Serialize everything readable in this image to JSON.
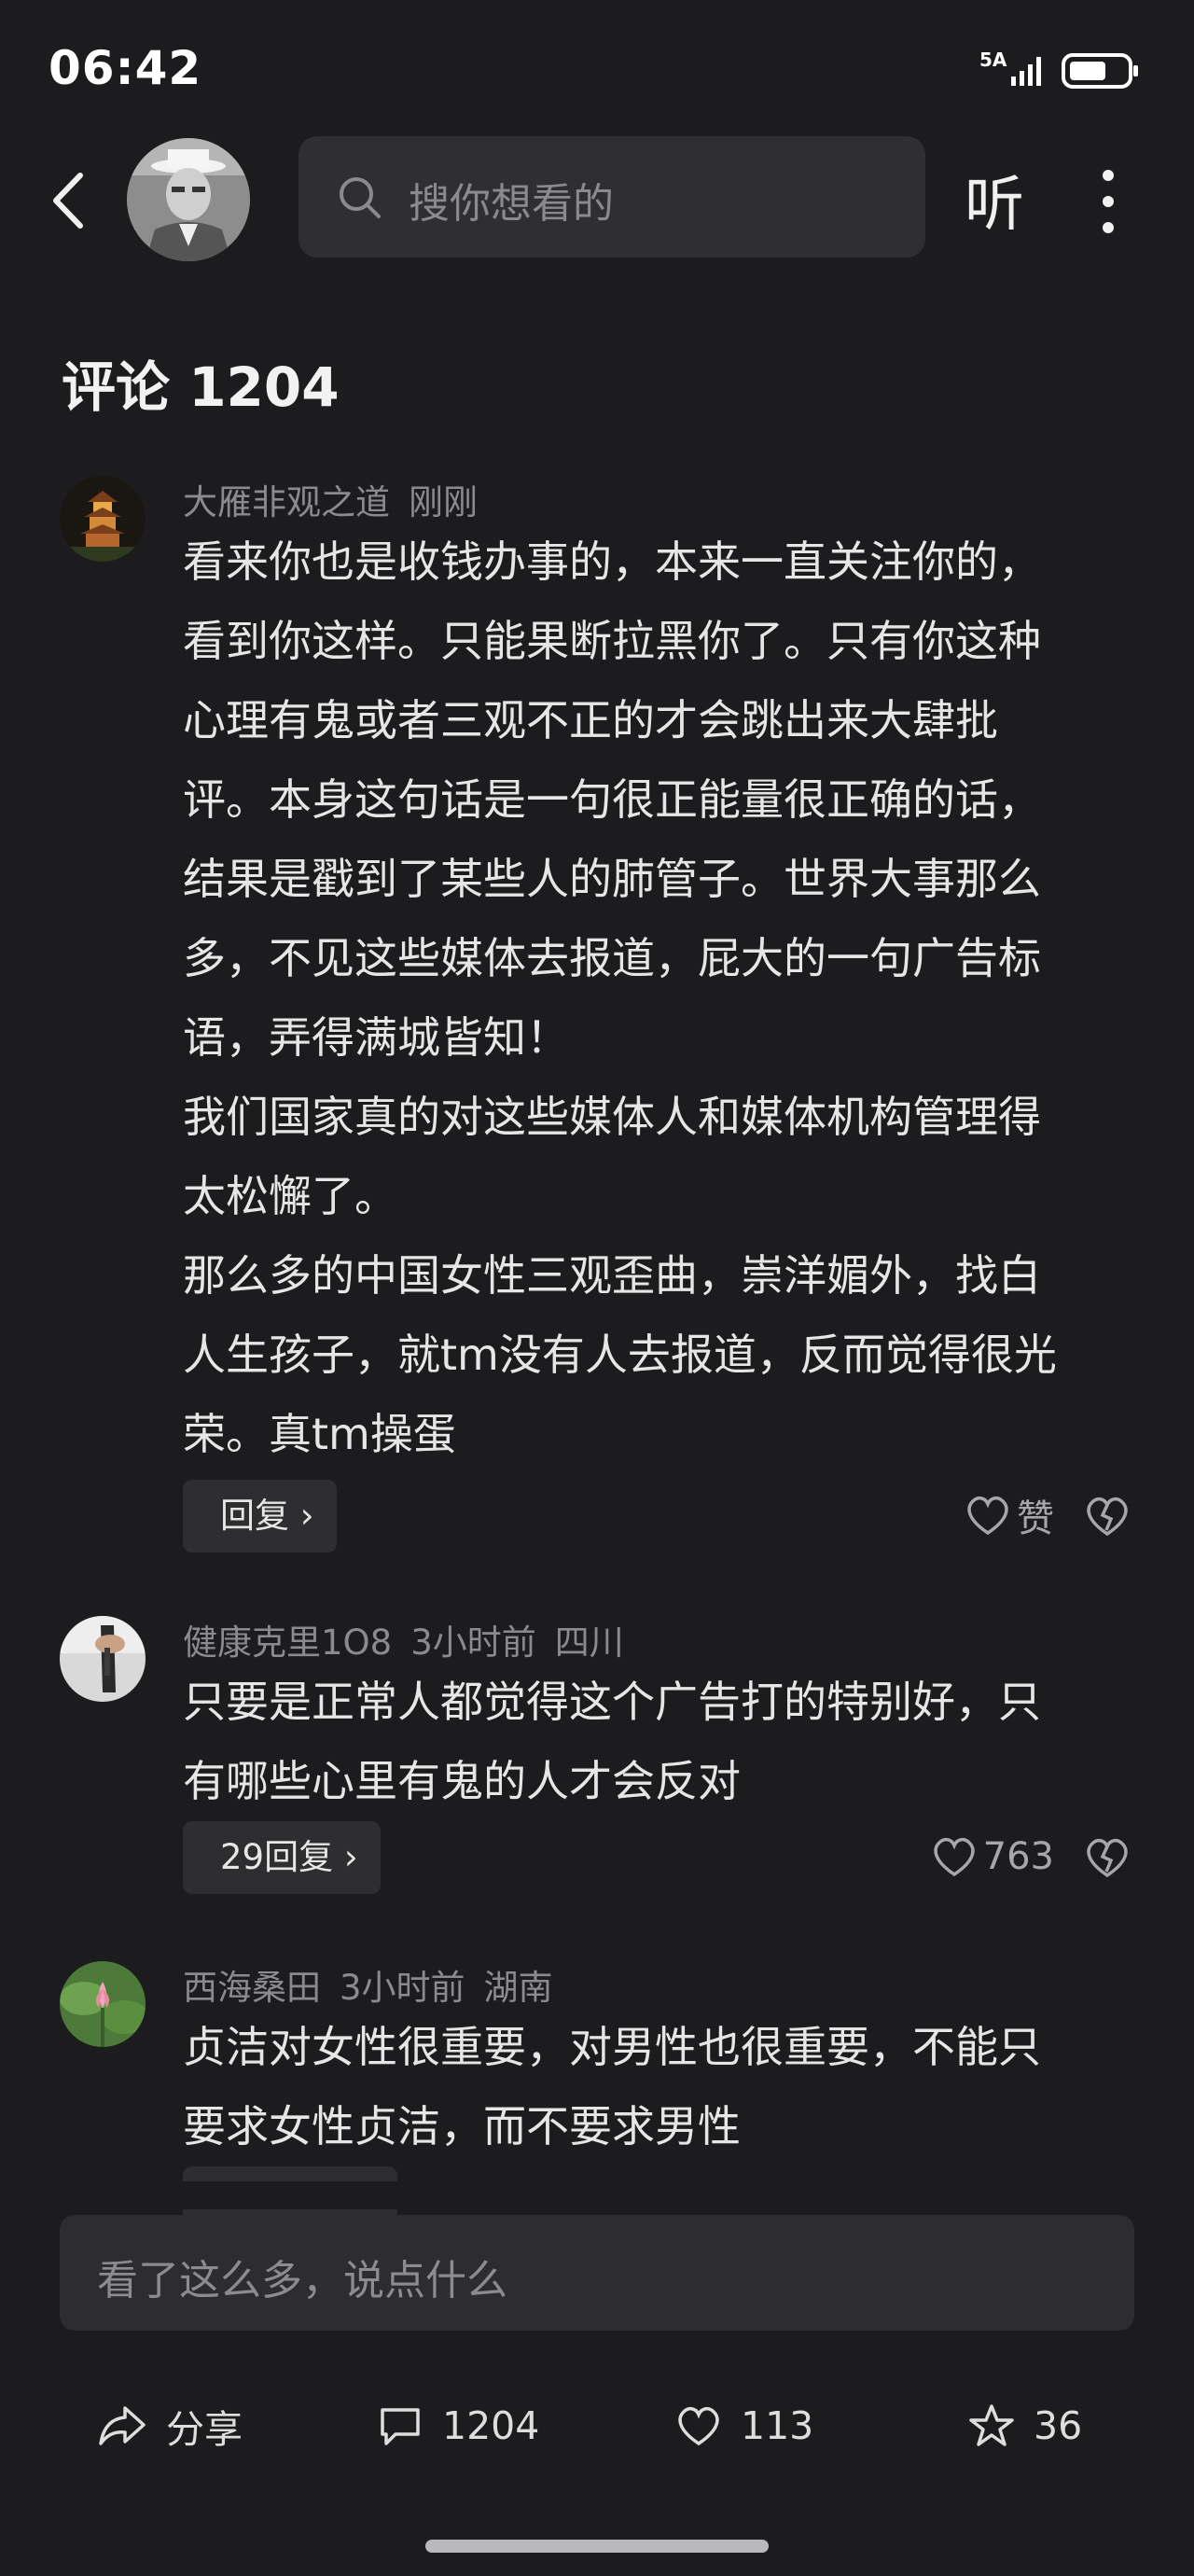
{
  "status": {
    "time": "06:42",
    "network": "5A",
    "battery_level": 0.6
  },
  "header": {
    "search_placeholder": "搜你想看的",
    "listen_label": "听"
  },
  "comments_title": "评论 1204",
  "comments": [
    {
      "user": "大雁非观之道",
      "time": "刚刚",
      "location": "",
      "lines": [
        "看来你也是收钱办事的，本来一直关注你的，",
        "看到你这样。只能果断拉黑你了。只有你这种",
        "心理有鬼或者三观不正的才会跳出来大肆批",
        "评。本身这句话是一句很正能量很正确的话，",
        "结果是戳到了某些人的肺管子。世界大事那么",
        "多，不见这些媒体去报道，屁大的一句广告标",
        "语，弄得满城皆知！",
        "我们国家真的对这些媒体人和媒体机构管理得",
        "太松懈了。",
        "那么多的中国女性三观歪曲，崇洋媚外，找白",
        "人生孩子，就tm没有人去报道，反而觉得很光",
        "荣。真tm操蛋"
      ],
      "reply_label": "回复",
      "like_label": "赞"
    },
    {
      "user": "健康克里1O8",
      "time": "3小时前",
      "location": "四川",
      "lines": [
        "只要是正常人都觉得这个广告打的特别好，只",
        "有哪些心里有鬼的人才会反对"
      ],
      "reply_label": "29回复",
      "like_label": "763"
    },
    {
      "user": "西海桑田",
      "time": "3小时前",
      "location": "湖南",
      "lines": [
        "贞洁对女性很重要，对男性也很重要，不能只",
        "要求女性贞洁，而不要求男性"
      ],
      "reply_label": "",
      "like_label": ""
    }
  ],
  "input_placeholder": "看了这么多，说点什么",
  "bottom_bar": {
    "share_label": "分享",
    "comment_count": "1204",
    "like_count": "113",
    "favorite_count": "36"
  },
  "icons": [
    "back-icon",
    "search-icon",
    "more-icon",
    "heart-icon",
    "broken-heart-icon",
    "share-icon",
    "comment-icon",
    "star-icon"
  ],
  "colors": {
    "background": "#1c1c1e",
    "surface": "#2e2e30",
    "muted_text": "#8b8b8d"
  }
}
